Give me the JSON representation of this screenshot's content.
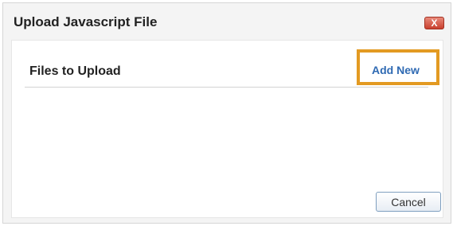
{
  "dialog": {
    "title": "Upload Javascript File",
    "close_label": "X"
  },
  "panel": {
    "files_label": "Files to Upload",
    "add_new_label": "Add New"
  },
  "footer": {
    "cancel_label": "Cancel"
  },
  "colors": {
    "highlight": "#e39a22",
    "link": "#2f6ab3",
    "close_button": "#c9402e"
  }
}
